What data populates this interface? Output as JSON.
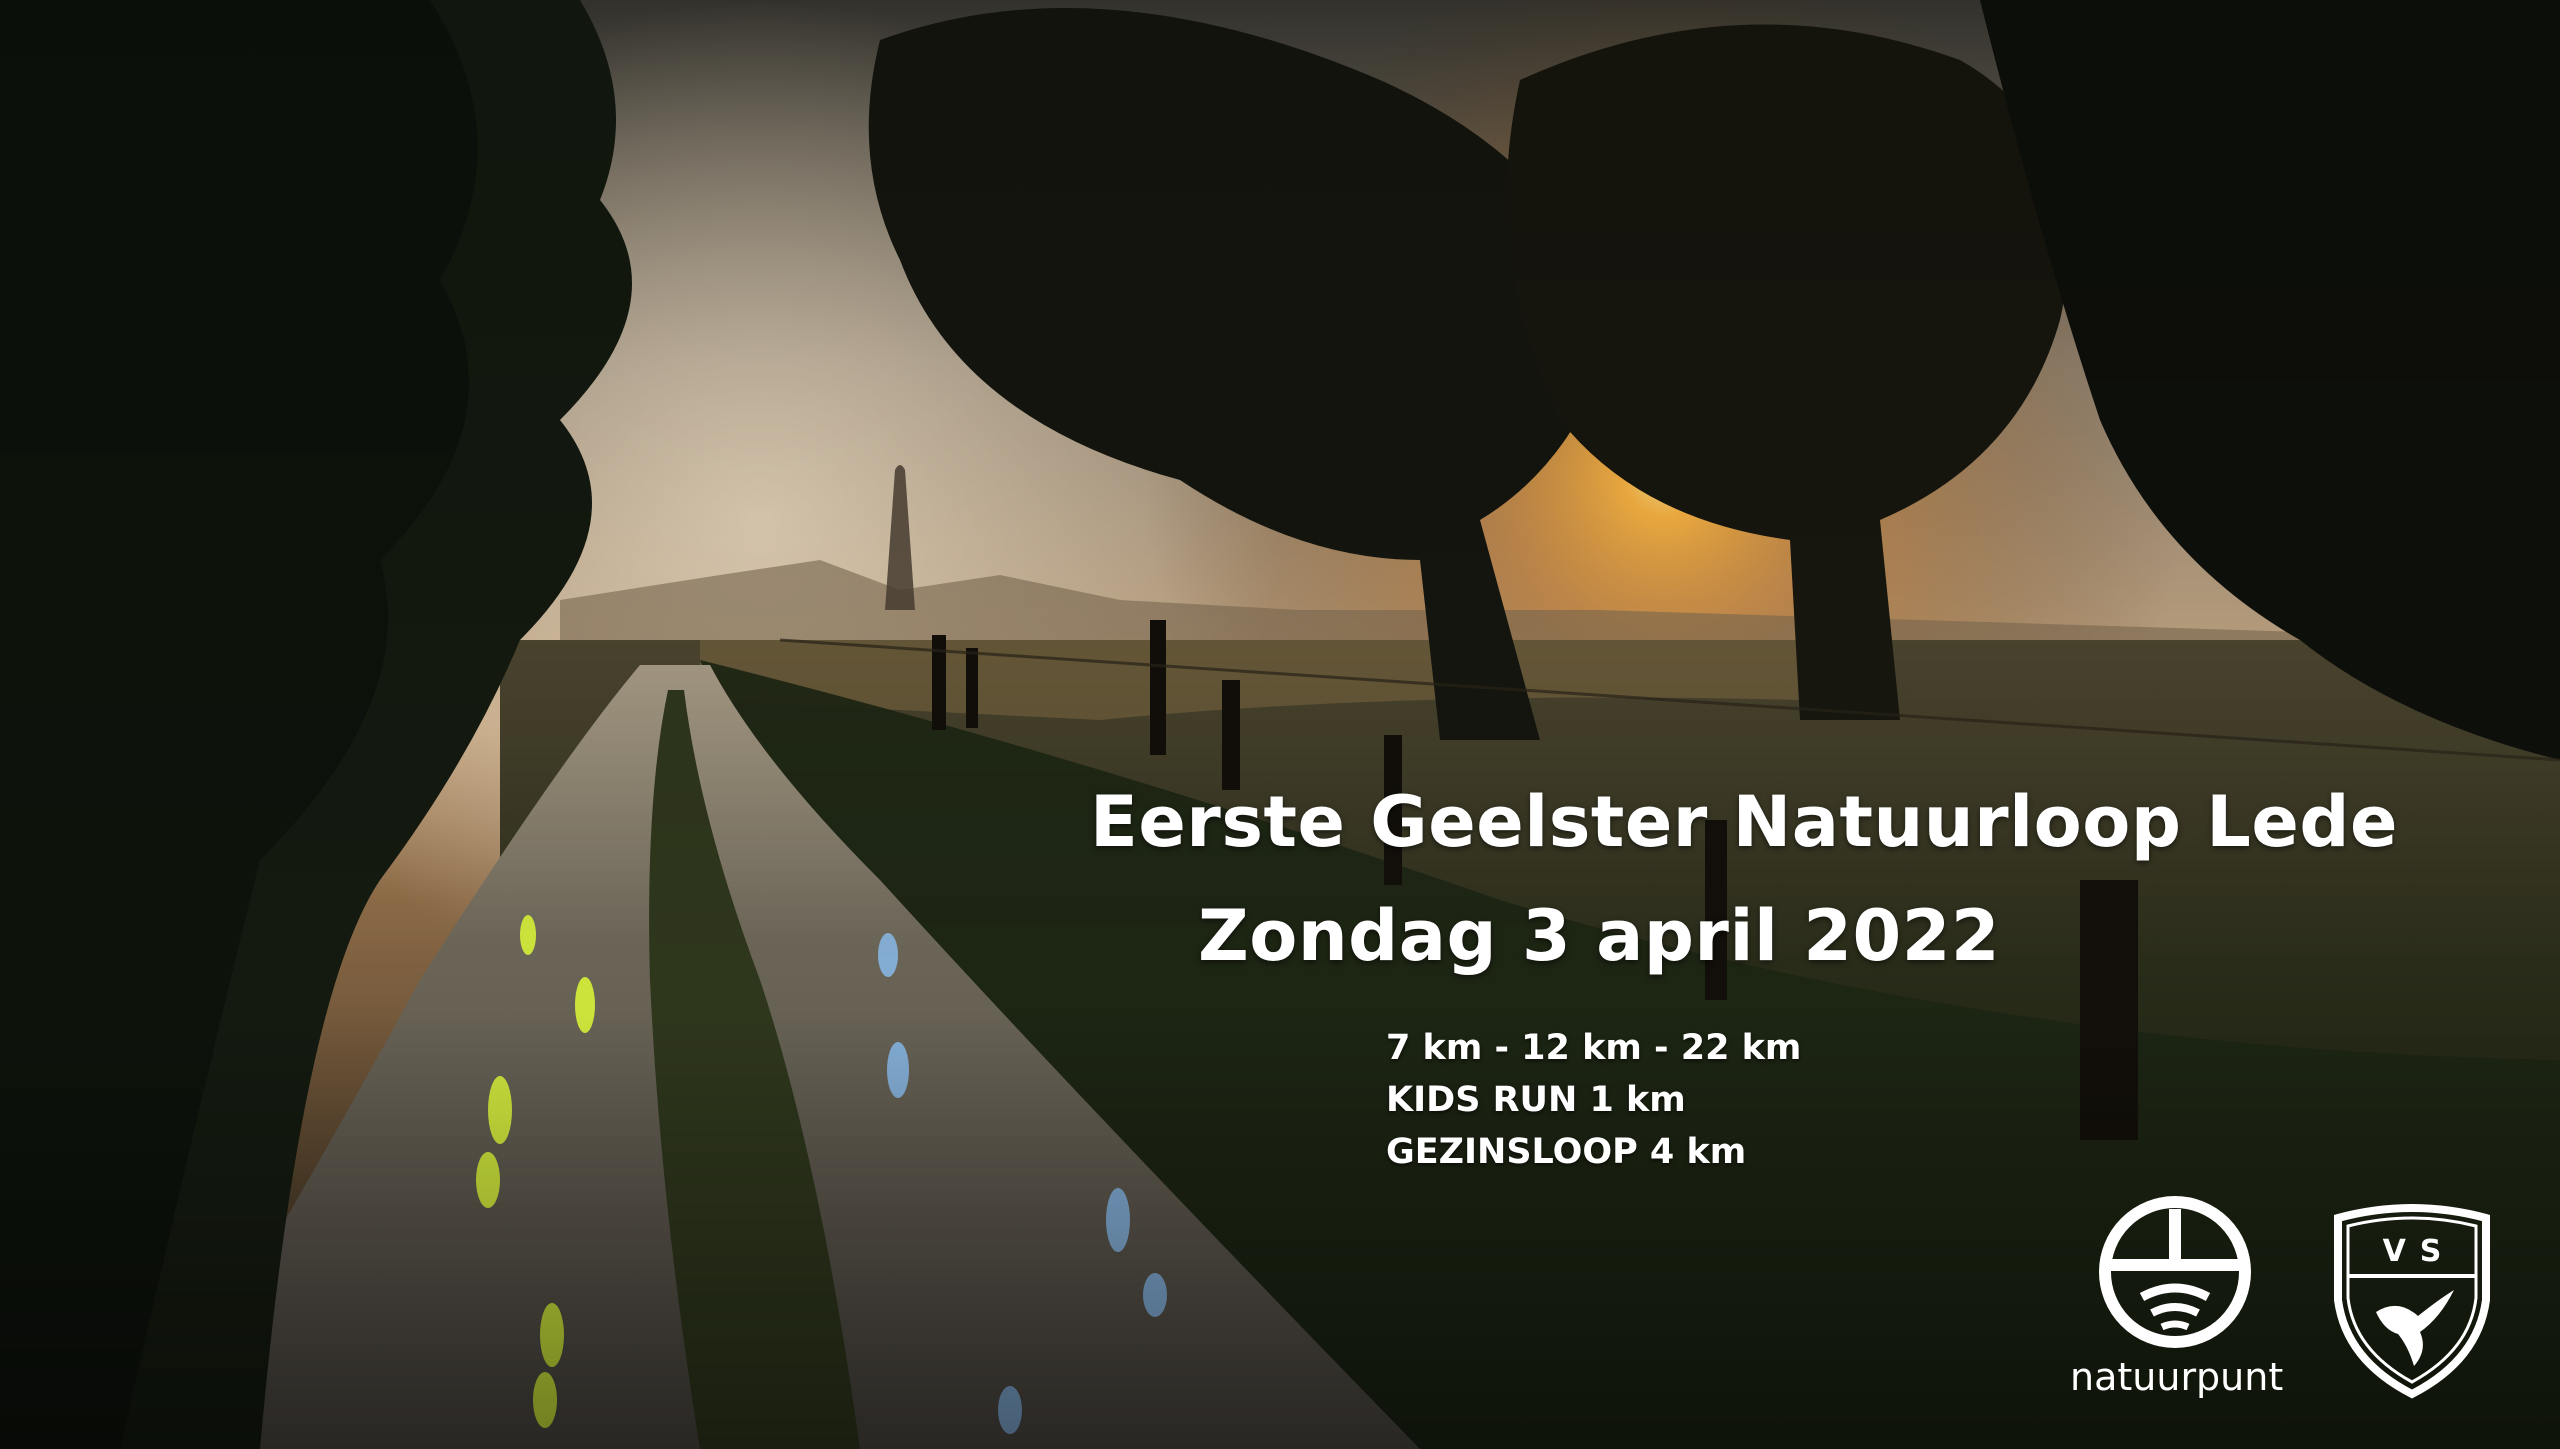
{
  "poster": {
    "title": "Eerste Geelster Natuurloop Lede",
    "date": "Zondag 3 april 2022",
    "distances": [
      "7 km - 12 km - 22 km",
      "KIDS RUN 1 km",
      "GEZINSLOOP 4 km"
    ]
  },
  "logos": {
    "natuurpunt": "natuurpunt",
    "club": "VS"
  },
  "colors": {
    "text": "#ffffff",
    "sun": "#ffb640",
    "footprint_yellow": "#d8f23a",
    "footprint_blue": "#8ec7ff",
    "foliage": "#1b2414"
  }
}
